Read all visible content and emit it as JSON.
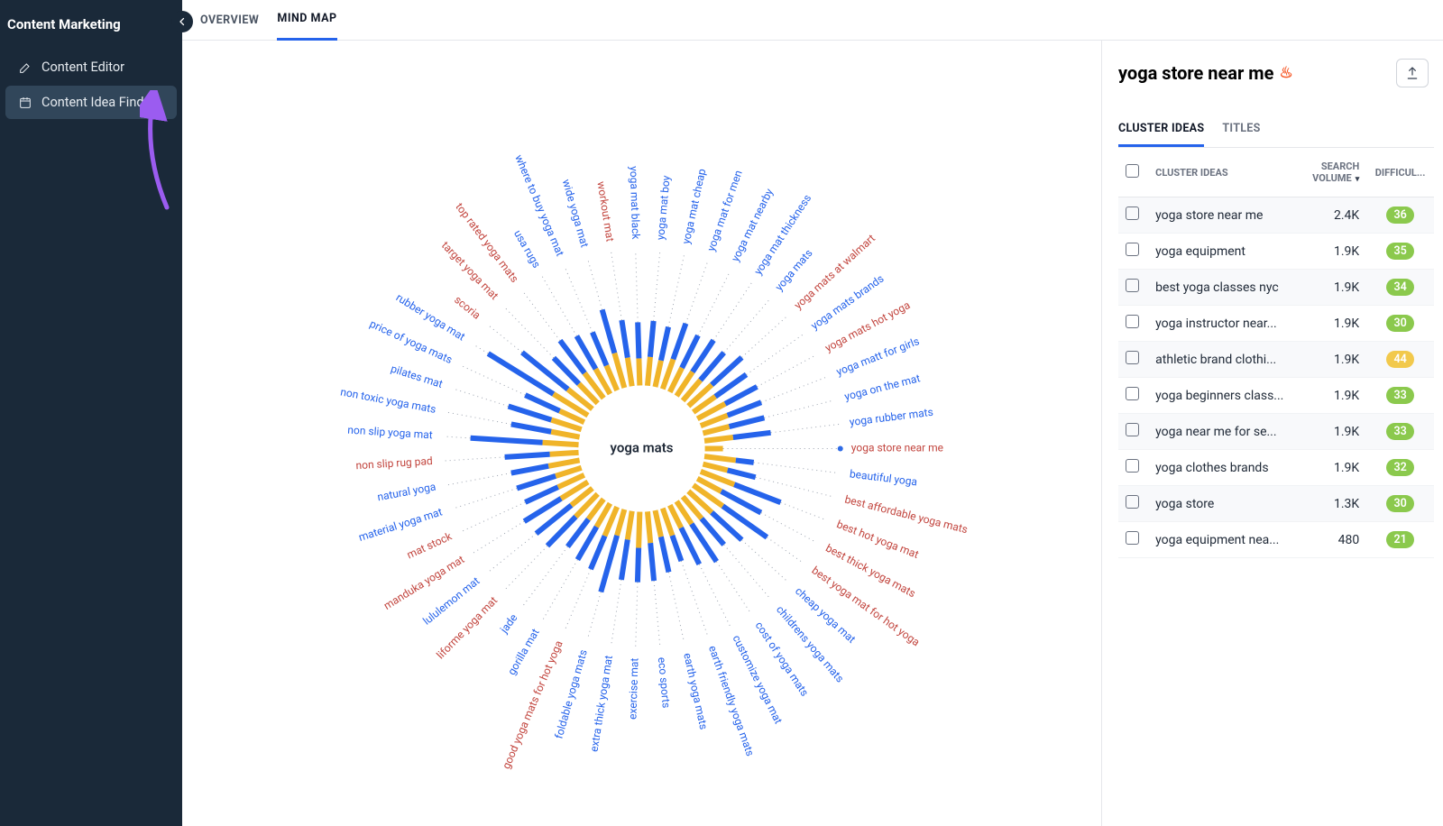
{
  "sidebar": {
    "title": "Content Marketing",
    "items": [
      {
        "label": "Content Editor"
      },
      {
        "label": "Content Idea Finder"
      }
    ]
  },
  "tabs": [
    {
      "label": "OVERVIEW"
    },
    {
      "label": "MIND MAP"
    }
  ],
  "mindmap": {
    "center": "yoga mats",
    "selected": "yoga store near me",
    "nodes": [
      {
        "label": "yoga store near me",
        "color": "red",
        "inner": 0.2,
        "outer": 0.0
      },
      {
        "label": "beautiful yoga",
        "color": "blue",
        "inner": 0.35,
        "outer": 0.2
      },
      {
        "label": "best affordable yoga mats",
        "color": "red",
        "inner": 0.28,
        "outer": 0.32
      },
      {
        "label": "best hot yoga mat",
        "color": "red",
        "inner": 0.4,
        "outer": 0.55
      },
      {
        "label": "best thick yoga mats",
        "color": "red",
        "inner": 0.3,
        "outer": 0.5
      },
      {
        "label": "best yoga mat for hot yoga",
        "color": "red",
        "inner": 0.4,
        "outer": 0.6
      },
      {
        "label": "cheap yoga mat",
        "color": "blue",
        "inner": 0.35,
        "outer": 0.45
      },
      {
        "label": "childrens yoga mats",
        "color": "blue",
        "inner": 0.32,
        "outer": 0.38
      },
      {
        "label": "cost of yoga mats",
        "color": "blue",
        "inner": 0.3,
        "outer": 0.5
      },
      {
        "label": "customize yoga mat",
        "color": "blue",
        "inner": 0.28,
        "outer": 0.45
      },
      {
        "label": "earth friendly yoga mats",
        "color": "blue",
        "inner": 0.32,
        "outer": 0.3
      },
      {
        "label": "earth yoga mats",
        "color": "blue",
        "inner": 0.3,
        "outer": 0.4
      },
      {
        "label": "eco sports",
        "color": "blue",
        "inner": 0.35,
        "outer": 0.42
      },
      {
        "label": "exercise mat",
        "color": "blue",
        "inner": 0.4,
        "outer": 0.38
      },
      {
        "label": "extra thick yoga mat",
        "color": "blue",
        "inner": 0.32,
        "outer": 0.45
      },
      {
        "label": "foldable yoga mats",
        "color": "blue",
        "inner": 0.3,
        "outer": 0.65
      },
      {
        "label": "good yoga mats for hot yoga",
        "color": "red",
        "inner": 0.35,
        "outer": 0.4
      },
      {
        "label": "gorilla mat",
        "color": "blue",
        "inner": 0.3,
        "outer": 0.42
      },
      {
        "label": "jade",
        "color": "blue",
        "inner": 0.28,
        "outer": 0.38
      },
      {
        "label": "liforme yoga mat",
        "color": "red",
        "inner": 0.35,
        "outer": 0.45
      },
      {
        "label": "lululemon mat",
        "color": "blue",
        "inner": 0.3,
        "outer": 0.5
      },
      {
        "label": "manduka yoga mat",
        "color": "red",
        "inner": 0.35,
        "outer": 0.48
      },
      {
        "label": "mat stock",
        "color": "red",
        "inner": 0.32,
        "outer": 0.4
      },
      {
        "label": "material yoga mat",
        "color": "blue",
        "inner": 0.3,
        "outer": 0.45
      },
      {
        "label": "natural yoga",
        "color": "blue",
        "inner": 0.35,
        "outer": 0.42
      },
      {
        "label": "non slip rug pad",
        "color": "red",
        "inner": 0.32,
        "outer": 0.5
      },
      {
        "label": "non slip yoga mat",
        "color": "blue",
        "inner": 0.4,
        "outer": 0.8
      },
      {
        "label": "non toxic yoga mats",
        "color": "blue",
        "inner": 0.32,
        "outer": 0.45
      },
      {
        "label": "pilates mat",
        "color": "blue",
        "inner": 0.35,
        "outer": 0.5
      },
      {
        "label": "price of yoga mats",
        "color": "blue",
        "inner": 0.3,
        "outer": 0.42
      },
      {
        "label": "rubber yoga mat",
        "color": "blue",
        "inner": 0.45,
        "outer": 0.85
      },
      {
        "label": "scoria",
        "color": "red",
        "inner": 0.35,
        "outer": 0.65
      },
      {
        "label": "target yoga mat",
        "color": "red",
        "inner": 0.3,
        "outer": 0.4
      },
      {
        "label": "top rated yoga mats",
        "color": "red",
        "inner": 0.35,
        "outer": 0.45
      },
      {
        "label": "usa rugs",
        "color": "blue",
        "inner": 0.32,
        "outer": 0.42
      },
      {
        "label": "where to buy yoga mat",
        "color": "blue",
        "inner": 0.3,
        "outer": 0.4
      },
      {
        "label": "wide yoga mat",
        "color": "blue",
        "inner": 0.4,
        "outer": 0.5
      },
      {
        "label": "workout mat",
        "color": "red",
        "inner": 0.32,
        "outer": 0.42
      },
      {
        "label": "yoga mat black",
        "color": "blue",
        "inner": 0.3,
        "outer": 0.4
      },
      {
        "label": "yoga mat boy",
        "color": "blue",
        "inner": 0.32,
        "outer": 0.4
      },
      {
        "label": "yoga mat cheap",
        "color": "blue",
        "inner": 0.3,
        "outer": 0.38
      },
      {
        "label": "yoga mat for men",
        "color": "blue",
        "inner": 0.35,
        "outer": 0.42
      },
      {
        "label": "yoga mat nearby",
        "color": "blue",
        "inner": 0.3,
        "outer": 0.4
      },
      {
        "label": "yoga mat thickness",
        "color": "blue",
        "inner": 0.32,
        "outer": 0.42
      },
      {
        "label": "yoga mats",
        "color": "blue",
        "inner": 0.3,
        "outer": 0.4
      },
      {
        "label": "yoga mats at walmart",
        "color": "red",
        "inner": 0.35,
        "outer": 0.45
      },
      {
        "label": "yoga mats brands",
        "color": "blue",
        "inner": 0.3,
        "outer": 0.42
      },
      {
        "label": "yoga mats hot yoga",
        "color": "red",
        "inner": 0.35,
        "outer": 0.4
      },
      {
        "label": "yoga matt for girls",
        "color": "blue",
        "inner": 0.32,
        "outer": 0.4
      },
      {
        "label": "yoga on the mat",
        "color": "blue",
        "inner": 0.3,
        "outer": 0.4
      },
      {
        "label": "yoga rubber mats",
        "color": "blue",
        "inner": 0.32,
        "outer": 0.42
      }
    ]
  },
  "panel": {
    "title": "yoga store near me",
    "subtabs": [
      {
        "label": "CLUSTER IDEAS"
      },
      {
        "label": "TITLES"
      }
    ],
    "columns": {
      "name": "CLUSTER IDEAS",
      "sv": "SEARCH VOLUME",
      "diff": "DIFFICUL..."
    },
    "rows": [
      {
        "name": "yoga store near me",
        "sv": "2.4K",
        "diff": 36,
        "diffColor": "green"
      },
      {
        "name": "yoga equipment",
        "sv": "1.9K",
        "diff": 35,
        "diffColor": "green"
      },
      {
        "name": "best yoga classes nyc",
        "sv": "1.9K",
        "diff": 34,
        "diffColor": "green"
      },
      {
        "name": "yoga instructor near...",
        "sv": "1.9K",
        "diff": 30,
        "diffColor": "green"
      },
      {
        "name": "athletic brand clothi...",
        "sv": "1.9K",
        "diff": 44,
        "diffColor": "yellow"
      },
      {
        "name": "yoga beginners class...",
        "sv": "1.9K",
        "diff": 33,
        "diffColor": "green"
      },
      {
        "name": "yoga near me for se...",
        "sv": "1.9K",
        "diff": 33,
        "diffColor": "green"
      },
      {
        "name": "yoga clothes brands",
        "sv": "1.9K",
        "diff": 32,
        "diffColor": "green"
      },
      {
        "name": "yoga store",
        "sv": "1.3K",
        "diff": 30,
        "diffColor": "green"
      },
      {
        "name": "yoga equipment nea...",
        "sv": "480",
        "diff": 21,
        "diffColor": "green"
      }
    ]
  }
}
